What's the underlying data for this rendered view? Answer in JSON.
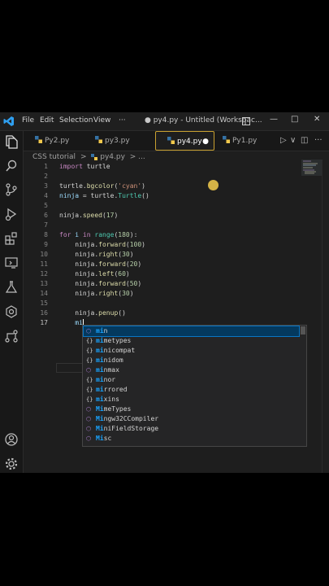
{
  "titlebar": {
    "menus": [
      "File",
      "Edit",
      "Selection",
      "View",
      "···"
    ],
    "title": "● py4.py - Untitled (Workspac...",
    "controls": [
      "—",
      "□",
      "✕"
    ]
  },
  "tabs": [
    {
      "label": "Py2.py"
    },
    {
      "label": "py3.py"
    },
    {
      "label": "py4.py",
      "modified": "●"
    },
    {
      "label": "Py1.py"
    }
  ],
  "tab_actions": [
    "▷",
    "∨",
    "◫",
    "···"
  ],
  "breadcrumb": {
    "folder": "CSS tutorial",
    "sep": ">",
    "file": "py4.py",
    "tail": "> ..."
  },
  "activity_icons": [
    "explorer-icon",
    "search-icon",
    "source-control-icon",
    "run-debug-icon",
    "extensions-icon",
    "remote-explorer-icon",
    "testing-icon",
    "copilot-icon",
    "github-icon",
    "account-icon",
    "settings-gear-icon"
  ],
  "code": {
    "line_numbers": [
      "1",
      "2",
      "3",
      "4",
      "5",
      "6",
      "7",
      "8",
      "9",
      "10",
      "11",
      "12",
      "13",
      "14",
      "15",
      "16",
      "17"
    ],
    "l1_kw": "import",
    "l1_rest": " turtle",
    "l3_a": "turtle.",
    "l3_fn": "bgcolor",
    "l3_p1": "(",
    "l3_str": "'cyan'",
    "l3_p2": ")",
    "l4_var": "ninja",
    "l4_eq": " = turtle.",
    "l4_cls": "Turtle",
    "l4_end": "()",
    "l6_a": "ninja.",
    "l6_fn": "speed",
    "l6_p1": "(",
    "l6_num": "17",
    "l6_p2": ")",
    "l8_kw1": "for",
    "l8_var": " i ",
    "l8_kw2": "in",
    "l8_sp": " ",
    "l8_bi": "range",
    "l8_p1": "(",
    "l8_num": "180",
    "l8_p2": "):",
    "l9_a": "    ninja.",
    "l9_fn": "forward",
    "l9_p1": "(",
    "l9_num": "100",
    "l9_p2": ")",
    "l10_a": "    ninja.",
    "l10_fn": "right",
    "l10_p1": "(",
    "l10_num": "30",
    "l10_p2": ")",
    "l11_a": "    ninja.",
    "l11_fn": "forward",
    "l11_p1": "(",
    "l11_num": "20",
    "l11_p2": ")",
    "l12_a": "    ninja.",
    "l12_fn": "left",
    "l12_p1": "(",
    "l12_num": "60",
    "l12_p2": ")",
    "l13_a": "    ninja.",
    "l13_fn": "forward",
    "l13_p1": "(",
    "l13_num": "50",
    "l13_p2": ")",
    "l14_a": "    ninja.",
    "l14_fn": "right",
    "l14_p1": "(",
    "l14_num": "30",
    "l14_p2": ")",
    "l16_a": "    ninja.",
    "l16_fn": "penup",
    "l16_p": "()",
    "l17_typed": "    mi"
  },
  "suggestions": [
    {
      "icon": "cube",
      "match": "mi",
      "rest": "n"
    },
    {
      "icon": "braces",
      "match": "mi",
      "rest": "metypes"
    },
    {
      "icon": "braces",
      "match": "mi",
      "rest": "nicompat"
    },
    {
      "icon": "braces",
      "match": "mi",
      "rest": "nidom"
    },
    {
      "icon": "cube",
      "match": "mi",
      "rest": "nmax"
    },
    {
      "icon": "braces",
      "match": "mi",
      "rest": "nor"
    },
    {
      "icon": "braces",
      "match": "mi",
      "rest": "rrored"
    },
    {
      "icon": "braces",
      "match": "mi",
      "rest": "xins"
    },
    {
      "icon": "cube",
      "match": "Mi",
      "rest": "meTypes"
    },
    {
      "icon": "cube",
      "match": "Mi",
      "rest": "ngw32CCompiler"
    },
    {
      "icon": "cube",
      "match": "Mi",
      "rest": "niFieldStorage"
    },
    {
      "icon": "cube",
      "match": "Mi",
      "rest": "sc"
    }
  ],
  "colors": {
    "accent": "#0a76c4",
    "tab_highlight": "#c8a030",
    "cursor_dot": "#e8c34a"
  }
}
